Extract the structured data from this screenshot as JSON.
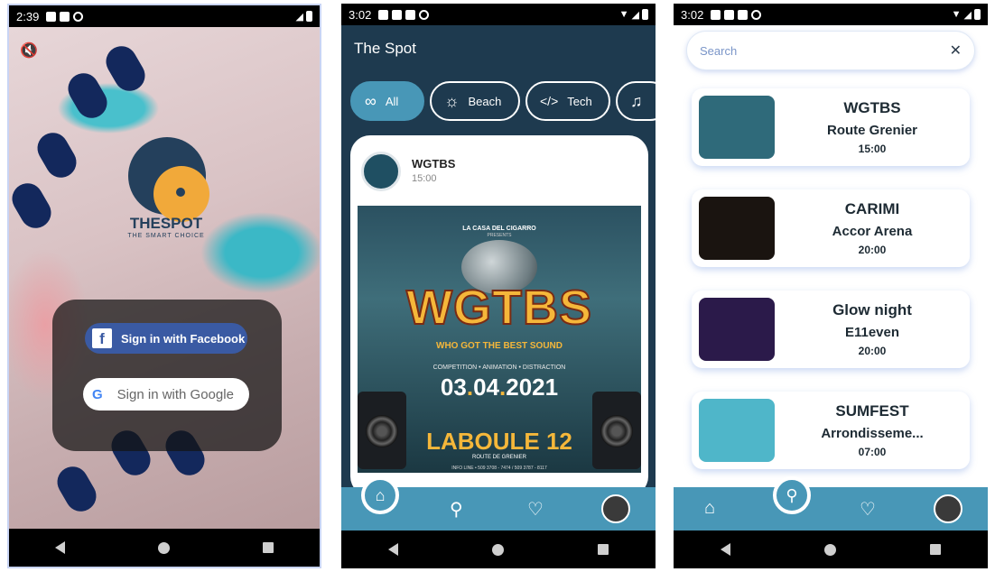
{
  "screen1": {
    "status_time": "2:39",
    "logo_title": "THESPOT",
    "logo_subtitle": "THE SMART CHOICE",
    "facebook_button": "Sign in with Facebook",
    "facebook_icon": "f",
    "google_button": "Sign in with Google",
    "google_icon": "G",
    "mute_icon": "🔇"
  },
  "screen2": {
    "status_time": "3:02",
    "app_title": "The Spot",
    "categories": [
      {
        "label": "All",
        "icon": "∞",
        "active": true
      },
      {
        "label": "Beach",
        "icon": "☼",
        "active": false
      },
      {
        "label": "Tech",
        "icon": "</>",
        "active": false
      },
      {
        "label": "",
        "icon": "♫",
        "active": false
      }
    ],
    "event": {
      "title": "WGTBS",
      "time": "15:00"
    },
    "poster": {
      "presenter": "LA CASA DEL CIGARRO",
      "presents": "PRESENTS",
      "headline": "WGTBS",
      "tagline": "WHO GOT THE BEST SOUND",
      "features": "COMPETITION • ANIMATION • DISTRACTION",
      "date_day": "03",
      "date_dot1": ".",
      "date_month": "04",
      "date_dot2": ".",
      "date_year": "2021",
      "venue": "LABOULE 12",
      "route": "ROUTE DE GRENIER",
      "info": "INFO LINE • 509 3708 - 7474 / 509 3787 - 8117"
    },
    "icons": {
      "home": "⌂",
      "search": "⚲",
      "favorite": "♡"
    }
  },
  "screen3": {
    "status_time": "3:02",
    "search_placeholder": "Search",
    "clear_icon": "✕",
    "results": [
      {
        "name": "WGTBS",
        "place": "Route Grenier",
        "time": "15:00",
        "color": "#2f6a7a"
      },
      {
        "name": "CARIMI",
        "place": "Accor Arena",
        "time": "20:00",
        "color": "#1a1410"
      },
      {
        "name": "Glow night",
        "place": "E11even",
        "time": "20:00",
        "color": "#2b1a4a"
      },
      {
        "name": "SUMFEST",
        "place": "Arrondisseme...",
        "time": "07:00",
        "color": "#4fb6c9"
      }
    ],
    "icons": {
      "home": "⌂",
      "search": "⚲",
      "favorite": "♡"
    }
  }
}
